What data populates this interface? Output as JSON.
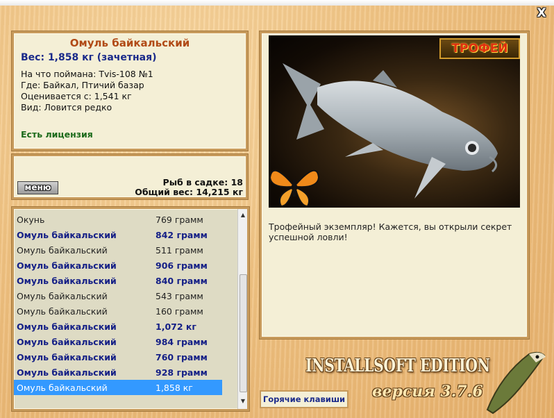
{
  "window": {
    "close_glyph": "X"
  },
  "info": {
    "fish_name": "Омуль байкальский",
    "weight": "Вес: 1,858 кг (зачетная)",
    "bait": "На что поймана: Tvis-108 №1",
    "place": "Где: Байкал, Птичий базар",
    "rated_from": "Оценивается с: 1,541 кг",
    "kind": "Вид: Ловится редко",
    "license": "Есть лицензия"
  },
  "stats": {
    "menu_label": "меню",
    "fish_in_cage": "Рыб в садке: 18",
    "total_weight": "Общий вес: 14,215 кг"
  },
  "catch_list": [
    {
      "name": "Окунь",
      "weight": "769 грамм",
      "trophy": false
    },
    {
      "name": "Омуль байкальский",
      "weight": "842 грамм",
      "trophy": true
    },
    {
      "name": "Омуль байкальский",
      "weight": "511 грамм",
      "trophy": false
    },
    {
      "name": "Омуль байкальский",
      "weight": "906 грамм",
      "trophy": true
    },
    {
      "name": "Омуль байкальский",
      "weight": "840 грамм",
      "trophy": true
    },
    {
      "name": "Омуль байкальский",
      "weight": "543 грамм",
      "trophy": false
    },
    {
      "name": "Омуль байкальский",
      "weight": "160 грамм",
      "trophy": false
    },
    {
      "name": "Омуль байкальский",
      "weight": "1,072 кг",
      "trophy": true
    },
    {
      "name": "Омуль байкальский",
      "weight": "984 грамм",
      "trophy": true
    },
    {
      "name": "Омуль байкальский",
      "weight": "760 грамм",
      "trophy": true
    },
    {
      "name": "Омуль байкальский",
      "weight": "928 грамм",
      "trophy": true
    },
    {
      "name": "Омуль байкальский",
      "weight": "1,858 кг",
      "trophy": false,
      "selected": true
    }
  ],
  "photo": {
    "badge": "ТРОФЕЙ",
    "description": "Трофейный экземпляр! Кажется, вы открыли секрет успешной ловли!"
  },
  "footer": {
    "hotkeys_label": "Горячие клавиши",
    "brand": "INSTALLSOFT EDITION",
    "version": "версия 3.7.6"
  },
  "colors": {
    "trophy_text": "#141f86",
    "title_text": "#b14a16",
    "license_text": "#1a6a1a",
    "selection": "#3399ff"
  }
}
